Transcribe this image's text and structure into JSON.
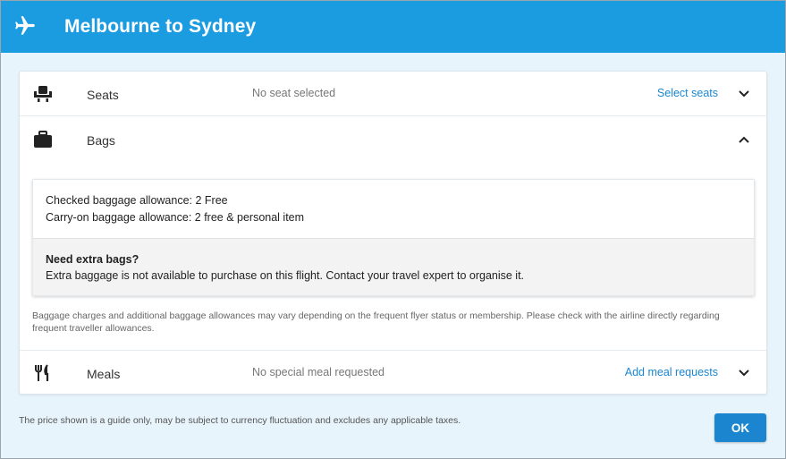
{
  "header": {
    "title": "Melbourne to Sydney",
    "icon": "airplane-icon",
    "background": "#1b9be0"
  },
  "seats": {
    "label": "Seats",
    "status": "No seat selected",
    "action": "Select seats",
    "icon": "seat-icon",
    "expanded": false
  },
  "bags": {
    "label": "Bags",
    "icon": "briefcase-icon",
    "expanded": true,
    "checked_allowance": "Checked baggage allowance: 2 Free",
    "carry_on_allowance": "Carry-on baggage allowance: 2 free & personal item",
    "extra_heading": "Need extra bags?",
    "extra_text": "Extra baggage is not available to purchase on this flight. Contact your travel expert to organise it.",
    "disclaimer": "Baggage charges and additional baggage allowances may vary depending on the frequent flyer status or membership. Please check with the airline directly regarding frequent traveller allowances."
  },
  "meals": {
    "label": "Meals",
    "status": "No special meal requested",
    "action": "Add meal requests",
    "icon": "fork-knife-icon",
    "expanded": false
  },
  "footer": {
    "note": "The price shown is a guide only, may be subject to currency fluctuation and excludes any applicable taxes.",
    "ok_label": "OK"
  },
  "colors": {
    "accent": "#1b86cf",
    "page_background": "#e8f4fc"
  }
}
